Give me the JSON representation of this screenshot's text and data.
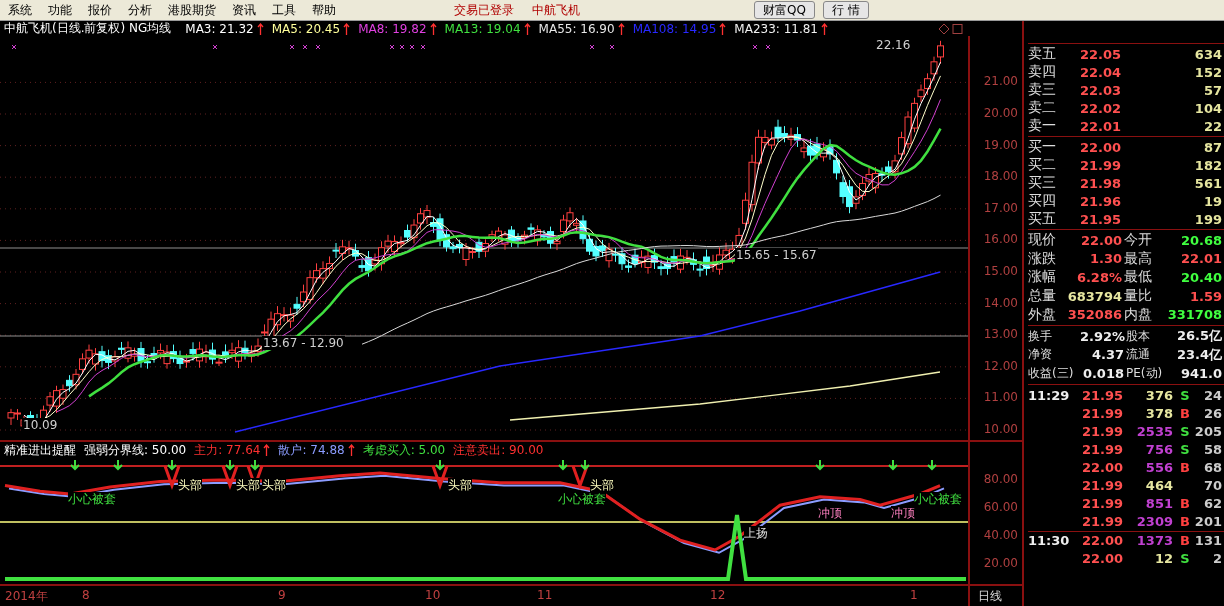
{
  "menu": [
    "系统",
    "功能",
    "报价",
    "分析",
    "港股期货",
    "资讯",
    "工具",
    "帮助"
  ],
  "status": [
    "交易已登录",
    "中航飞机"
  ],
  "toolbar_buttons": [
    "财富QQ",
    "行 情"
  ],
  "chart_header": {
    "title": "中航飞机(日线.前复权) NG均线",
    "ma": [
      {
        "label": "MA3: 21.32",
        "color": "#ffffff",
        "rising": true
      },
      {
        "label": "MA5: 20.45",
        "color": "#ffff9a",
        "rising": true
      },
      {
        "label": "MA8: 19.82",
        "color": "#e040e0",
        "rising": true
      },
      {
        "label": "MA13: 19.04",
        "color": "#40e040",
        "rising": true
      },
      {
        "label": "MA55: 16.90",
        "color": "#e6e6e6",
        "rising": true
      },
      {
        "label": "MA108: 14.95",
        "color": "#2828ff",
        "rising": true
      },
      {
        "label": "MA233: 11.81",
        "color": "#f0f0f0",
        "rising": true
      }
    ]
  },
  "price_axis": [
    "21.00",
    "20.00",
    "19.00",
    "18.00",
    "17.00",
    "16.00",
    "15.00",
    "14.00",
    "13.00",
    "12.00",
    "11.00",
    "10.00"
  ],
  "price_annotations": [
    "22.16",
    "15.65 - 15.67",
    "13.67 - 12.90",
    "10.09"
  ],
  "indicator": {
    "title": "精准进出提醒",
    "items": [
      {
        "label": "强弱分界线: 50.00",
        "color": "#ffffff",
        "rising": false
      },
      {
        "label": "主力: 77.64",
        "color": "#ff3030",
        "rising": true
      },
      {
        "label": "散户: 74.88",
        "color": "#8c9cff",
        "rising": true
      },
      {
        "label": "考虑买入: 5.00",
        "color": "#40e040",
        "rising": false
      },
      {
        "label": "注意卖出: 90.00",
        "color": "#ff3030",
        "rising": false
      }
    ],
    "axis": [
      "80.00",
      "60.00",
      "40.00",
      "20.00"
    ],
    "signals": [
      {
        "kind": "caution",
        "text": "小心被套"
      },
      {
        "kind": "top",
        "text": "头部"
      },
      {
        "kind": "top",
        "text": "头部"
      },
      {
        "kind": "top",
        "text": "头部"
      },
      {
        "kind": "top",
        "text": "头部"
      },
      {
        "kind": "caution",
        "text": "小心被套"
      },
      {
        "kind": "top",
        "text": "头部"
      },
      {
        "kind": "rise",
        "text": "上扬"
      },
      {
        "kind": "peak",
        "text": "冲顶"
      },
      {
        "kind": "peak",
        "text": "冲顶"
      },
      {
        "kind": "caution",
        "text": "小心被套"
      }
    ]
  },
  "time_axis": [
    "2014年",
    "8",
    "9",
    "10",
    "11",
    "12",
    "1"
  ],
  "period": "日线",
  "order_book": {
    "sell": [
      {
        "label": "卖五",
        "price": "22.05",
        "volume": "634"
      },
      {
        "label": "卖四",
        "price": "22.04",
        "volume": "152"
      },
      {
        "label": "卖三",
        "price": "22.03",
        "volume": "57"
      },
      {
        "label": "卖二",
        "price": "22.02",
        "volume": "104"
      },
      {
        "label": "卖一",
        "price": "22.01",
        "volume": "22"
      }
    ],
    "buy": [
      {
        "label": "买一",
        "price": "22.00",
        "volume": "87"
      },
      {
        "label": "买二",
        "price": "21.99",
        "volume": "182"
      },
      {
        "label": "买三",
        "price": "21.98",
        "volume": "561"
      },
      {
        "label": "买四",
        "price": "21.96",
        "volume": "19"
      },
      {
        "label": "买五",
        "price": "21.95",
        "volume": "199"
      }
    ]
  },
  "quote": [
    {
      "label": "现价",
      "value": "22.00",
      "color": "#ff5050"
    },
    {
      "label": "今开",
      "value": "20.68",
      "color": "#40ff40"
    },
    {
      "label": "涨跌",
      "value": "1.30",
      "color": "#ff5050"
    },
    {
      "label": "最高",
      "value": "22.01",
      "color": "#ff5050"
    },
    {
      "label": "涨幅",
      "value": "6.28%",
      "color": "#ff5050"
    },
    {
      "label": "最低",
      "value": "20.40",
      "color": "#40ff40"
    },
    {
      "label": "总量",
      "value": "683794",
      "color": "#e6e6a0"
    },
    {
      "label": "量比",
      "value": "1.59",
      "color": "#ff5050"
    },
    {
      "label": "外盘",
      "value": "352086",
      "color": "#ff5050"
    },
    {
      "label": "内盘",
      "value": "331708",
      "color": "#40ff40"
    }
  ],
  "finance": [
    {
      "label": "换手",
      "value": "2.92%"
    },
    {
      "label": "股本",
      "value": "26.5亿"
    },
    {
      "label": "净资",
      "value": "4.37"
    },
    {
      "label": "流通",
      "value": "23.4亿"
    },
    {
      "label": "收益(三)",
      "value": "0.018"
    },
    {
      "label": "PE(动)",
      "value": "941.0"
    }
  ],
  "ticks": [
    {
      "time": "11:29",
      "price": "21.95",
      "volume": "376",
      "big": false,
      "side": "S",
      "count": "24"
    },
    {
      "price": "21.99",
      "volume": "378",
      "big": false,
      "side": "B",
      "count": "26"
    },
    {
      "price": "21.99",
      "volume": "2535",
      "big": true,
      "side": "S",
      "count": "205"
    },
    {
      "price": "21.99",
      "volume": "756",
      "big": true,
      "side": "S",
      "count": "58"
    },
    {
      "price": "22.00",
      "volume": "556",
      "big": true,
      "side": "B",
      "count": "68"
    },
    {
      "price": "21.99",
      "volume": "464",
      "big": false,
      "count": "70"
    },
    {
      "price": "21.99",
      "volume": "851",
      "big": true,
      "side": "B",
      "count": "62"
    },
    {
      "price": "21.99",
      "volume": "2309",
      "big": true,
      "side": "B",
      "count": "201"
    },
    {
      "time": "11:30",
      "price": "22.00",
      "volume": "1373",
      "big": true,
      "side": "B",
      "count": "131"
    },
    {
      "price": "22.00",
      "volume": "12",
      "big": false,
      "side": "S",
      "count": "2"
    }
  ]
}
